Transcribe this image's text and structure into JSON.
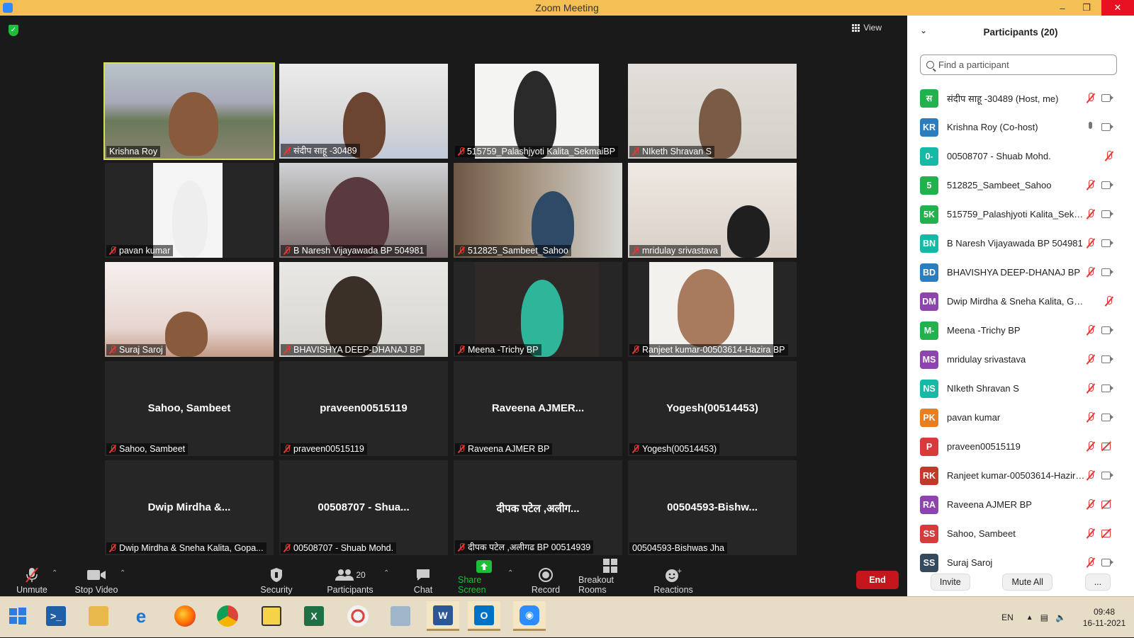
{
  "window": {
    "title": "Zoom Meeting"
  },
  "view_label": "View",
  "tiles": [
    {
      "name": "Krishna Roy",
      "big": "",
      "muted": false
    },
    {
      "name": "संदीप साहू -30489",
      "big": "",
      "muted": true
    },
    {
      "name": "515759_Palashjyoti Kalita_SekmaiBP",
      "big": "",
      "muted": true
    },
    {
      "name": "NIketh Shravan S",
      "big": "",
      "muted": true
    },
    {
      "name": "pavan kumar",
      "big": "",
      "muted": true
    },
    {
      "name": "B Naresh Vijayawada BP 504981",
      "big": "",
      "muted": true
    },
    {
      "name": "512825_Sambeet_Sahoo",
      "big": "",
      "muted": true
    },
    {
      "name": "mridulay srivastava",
      "big": "",
      "muted": true
    },
    {
      "name": "Suraj Saroj",
      "big": "",
      "muted": true
    },
    {
      "name": "BHAVISHYA DEEP-DHANAJ BP",
      "big": "",
      "muted": true
    },
    {
      "name": "Meena -Trichy BP",
      "big": "",
      "muted": true
    },
    {
      "name": "Ranjeet kumar-00503614-Hazira BP",
      "big": "",
      "muted": true
    },
    {
      "name": "Sahoo, Sambeet",
      "big": "Sahoo, Sambeet",
      "muted": true
    },
    {
      "name": "praveen00515119",
      "big": "praveen00515119",
      "muted": true
    },
    {
      "name": "Raveena AJMER BP",
      "big": "Raveena  AJMER...",
      "muted": true
    },
    {
      "name": "Yogesh(00514453)",
      "big": "Yogesh(00514453)",
      "muted": true
    },
    {
      "name": "Dwip Mirdha & Sneha Kalita, Gopa...",
      "big": "Dwip Mirdha &...",
      "muted": true
    },
    {
      "name": "00508707 - Shuab Mohd.",
      "big": "00508707 - Shua...",
      "muted": true
    },
    {
      "name": "दीपक पटेल ,अलीगढ BP 00514939",
      "big": "दीपक पटेल ,अलीग...",
      "muted": true
    },
    {
      "name": "00504593-Bishwas Jha",
      "big": "00504593-Bishw...",
      "muted": false
    }
  ],
  "participants": {
    "header": "Participants (20)",
    "search_placeholder": "Find a participant",
    "list": [
      {
        "initials": "स",
        "name": "संदीप साहू -30489 (Host, me)",
        "color": "#22b14c",
        "mic": "off",
        "cam": "on"
      },
      {
        "initials": "KR",
        "name": "Krishna Roy (Co-host)",
        "color": "#2d7dbd",
        "mic": "on",
        "cam": "on"
      },
      {
        "initials": "0-",
        "name": "00508707 - Shuab Mohd.",
        "color": "#15b9a6",
        "mic": "off",
        "cam": "none"
      },
      {
        "initials": "5",
        "name": "512825_Sambeet_Sahoo",
        "color": "#22b14c",
        "mic": "off",
        "cam": "on"
      },
      {
        "initials": "5K",
        "name": "515759_Palashjyoti Kalita_Sekm...",
        "color": "#22b14c",
        "mic": "off",
        "cam": "on"
      },
      {
        "initials": "BN",
        "name": "B Naresh Vijayawada BP 504981",
        "color": "#15b9a6",
        "mic": "off",
        "cam": "on"
      },
      {
        "initials": "BD",
        "name": "BHAVISHYA DEEP-DHANAJ BP",
        "color": "#2d7dbd",
        "mic": "off",
        "cam": "on"
      },
      {
        "initials": "DM",
        "name": "Dwip Mirdha & Sneha Kalita, Gopan...",
        "color": "#8e44ad",
        "mic": "off",
        "cam": "none"
      },
      {
        "initials": "M-",
        "name": "Meena -Trichy BP",
        "color": "#22b14c",
        "mic": "off",
        "cam": "on"
      },
      {
        "initials": "MS",
        "name": "mridulay srivastava",
        "color": "#8e44ad",
        "mic": "off",
        "cam": "on"
      },
      {
        "initials": "NS",
        "name": "NIketh Shravan S",
        "color": "#15b9a6",
        "mic": "off",
        "cam": "on"
      },
      {
        "initials": "PK",
        "name": "pavan kumar",
        "color": "#e67e22",
        "mic": "off",
        "cam": "on"
      },
      {
        "initials": "P",
        "name": "praveen00515119",
        "color": "#d63a3a",
        "mic": "off",
        "cam": "off"
      },
      {
        "initials": "RK",
        "name": "Ranjeet kumar-00503614-Hazira...",
        "color": "#c0392b",
        "mic": "off",
        "cam": "on"
      },
      {
        "initials": "RA",
        "name": "Raveena AJMER BP",
        "color": "#8e44ad",
        "mic": "off",
        "cam": "off"
      },
      {
        "initials": "SS",
        "name": "Sahoo, Sambeet",
        "color": "#d63a3a",
        "mic": "off",
        "cam": "off"
      },
      {
        "initials": "SS",
        "name": "Suraj Saroj",
        "color": "#34495e",
        "mic": "off",
        "cam": "on"
      }
    ],
    "invite": "Invite",
    "mute_all": "Mute All",
    "more": "..."
  },
  "toolbar": {
    "unmute": "Unmute",
    "stop_video": "Stop Video",
    "security": "Security",
    "participants": "Participants",
    "participants_count": "20",
    "chat": "Chat",
    "share_screen": "Share Screen",
    "record": "Record",
    "breakout": "Breakout Rooms",
    "reactions": "Reactions",
    "end": "End"
  },
  "taskbar": {
    "lang": "EN",
    "time": "09:48",
    "date": "16-11-2021"
  },
  "colors": {
    "title_bar": "#f4bf55",
    "share_green": "#1dbf3a",
    "end_red": "#c4161c",
    "active_speaker": "#d4e157"
  }
}
